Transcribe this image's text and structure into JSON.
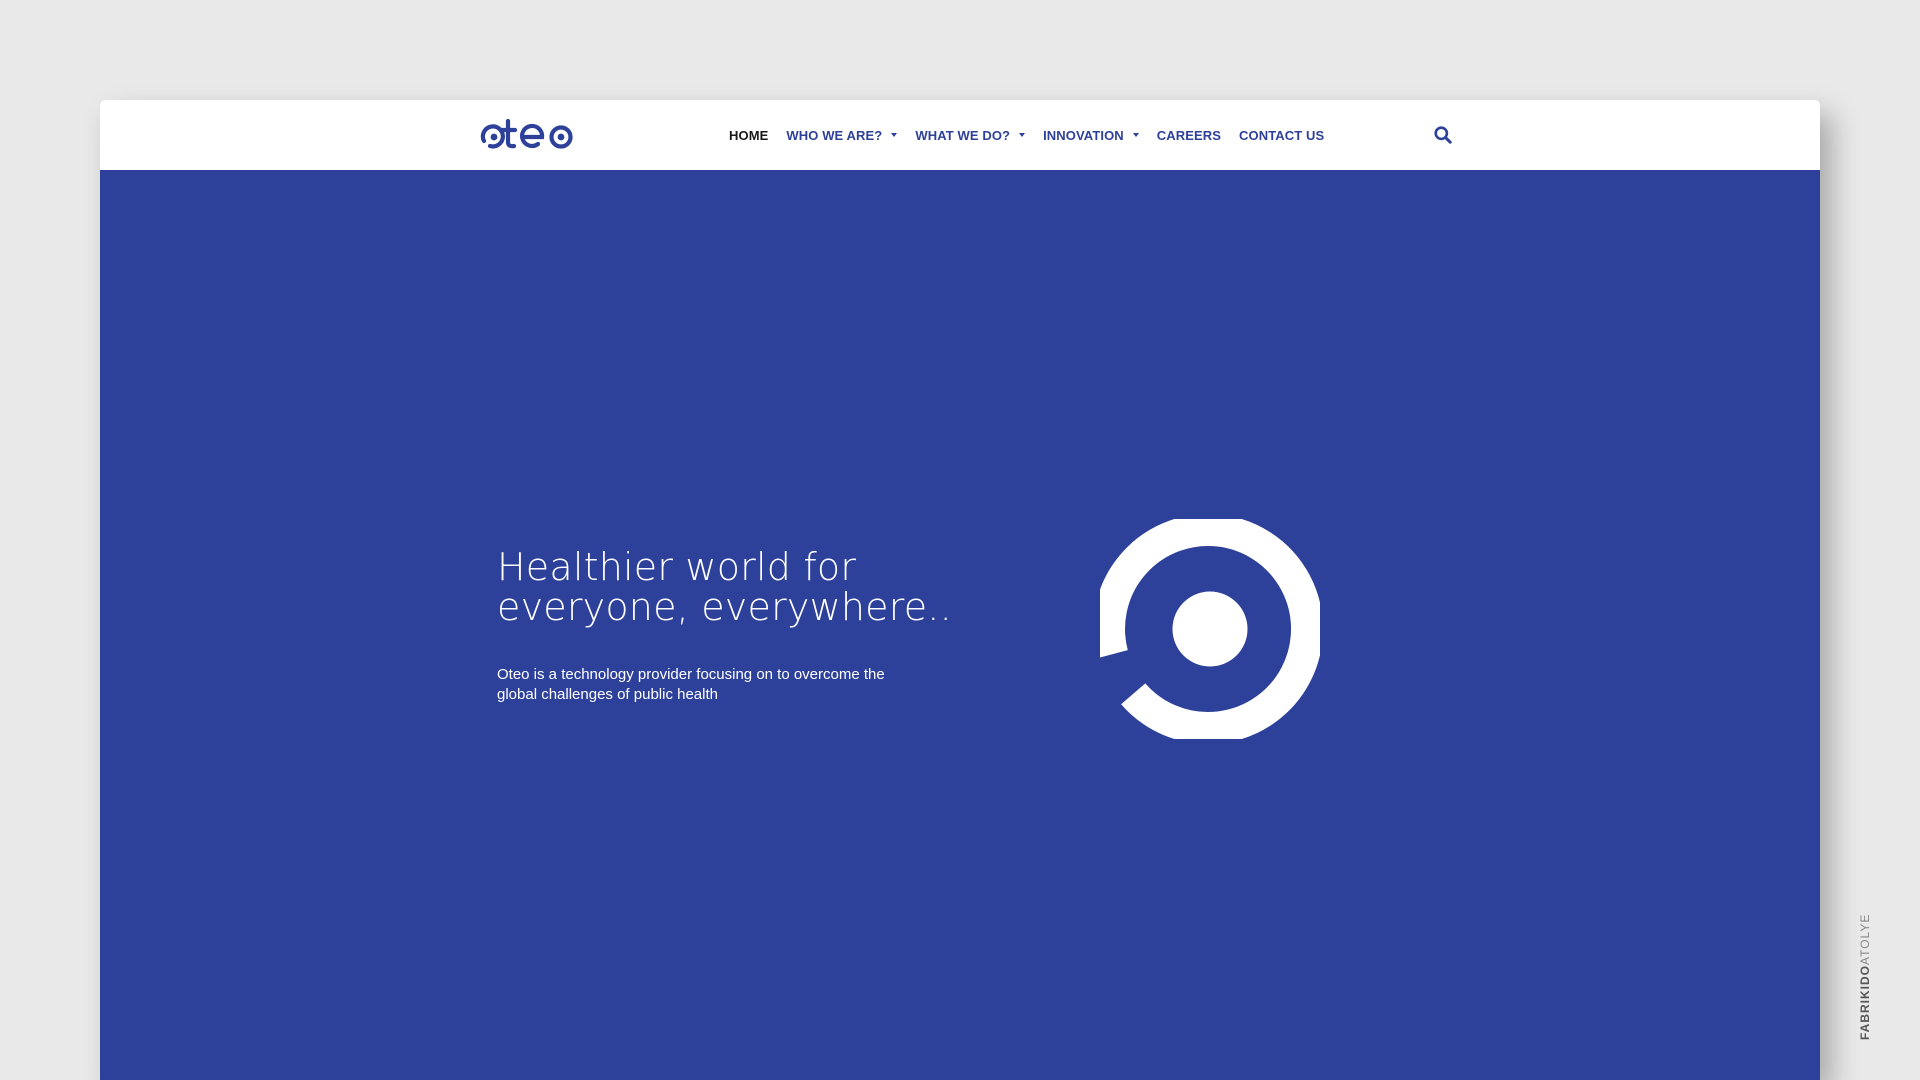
{
  "brand": {
    "logo_text": "oteo",
    "primary_color": "#2e419a",
    "header_background": "#ffffff",
    "page_background": "#e9e9e9"
  },
  "nav": {
    "items": [
      {
        "label": "HOME",
        "has_dropdown": false,
        "active": true
      },
      {
        "label": "WHO WE ARE?",
        "has_dropdown": true,
        "active": false
      },
      {
        "label": "WHAT WE DO?",
        "has_dropdown": true,
        "active": false
      },
      {
        "label": "INNOVATION",
        "has_dropdown": true,
        "active": false
      },
      {
        "label": "CAREERS",
        "has_dropdown": false,
        "active": false
      },
      {
        "label": "CONTACT US",
        "has_dropdown": false,
        "active": false
      }
    ],
    "search_icon": "search-icon"
  },
  "hero": {
    "title_line1": "Healthier world for",
    "title_line2": "everyone, everywhere..",
    "text_line1": "Oteo is a technology provider focusing on to overcome the",
    "text_line2": "global challenges of public health",
    "mark_icon": "oteo-o-mark-icon"
  },
  "watermark": {
    "bold": "FABRIKIDO",
    "light": "ATOLYE"
  }
}
